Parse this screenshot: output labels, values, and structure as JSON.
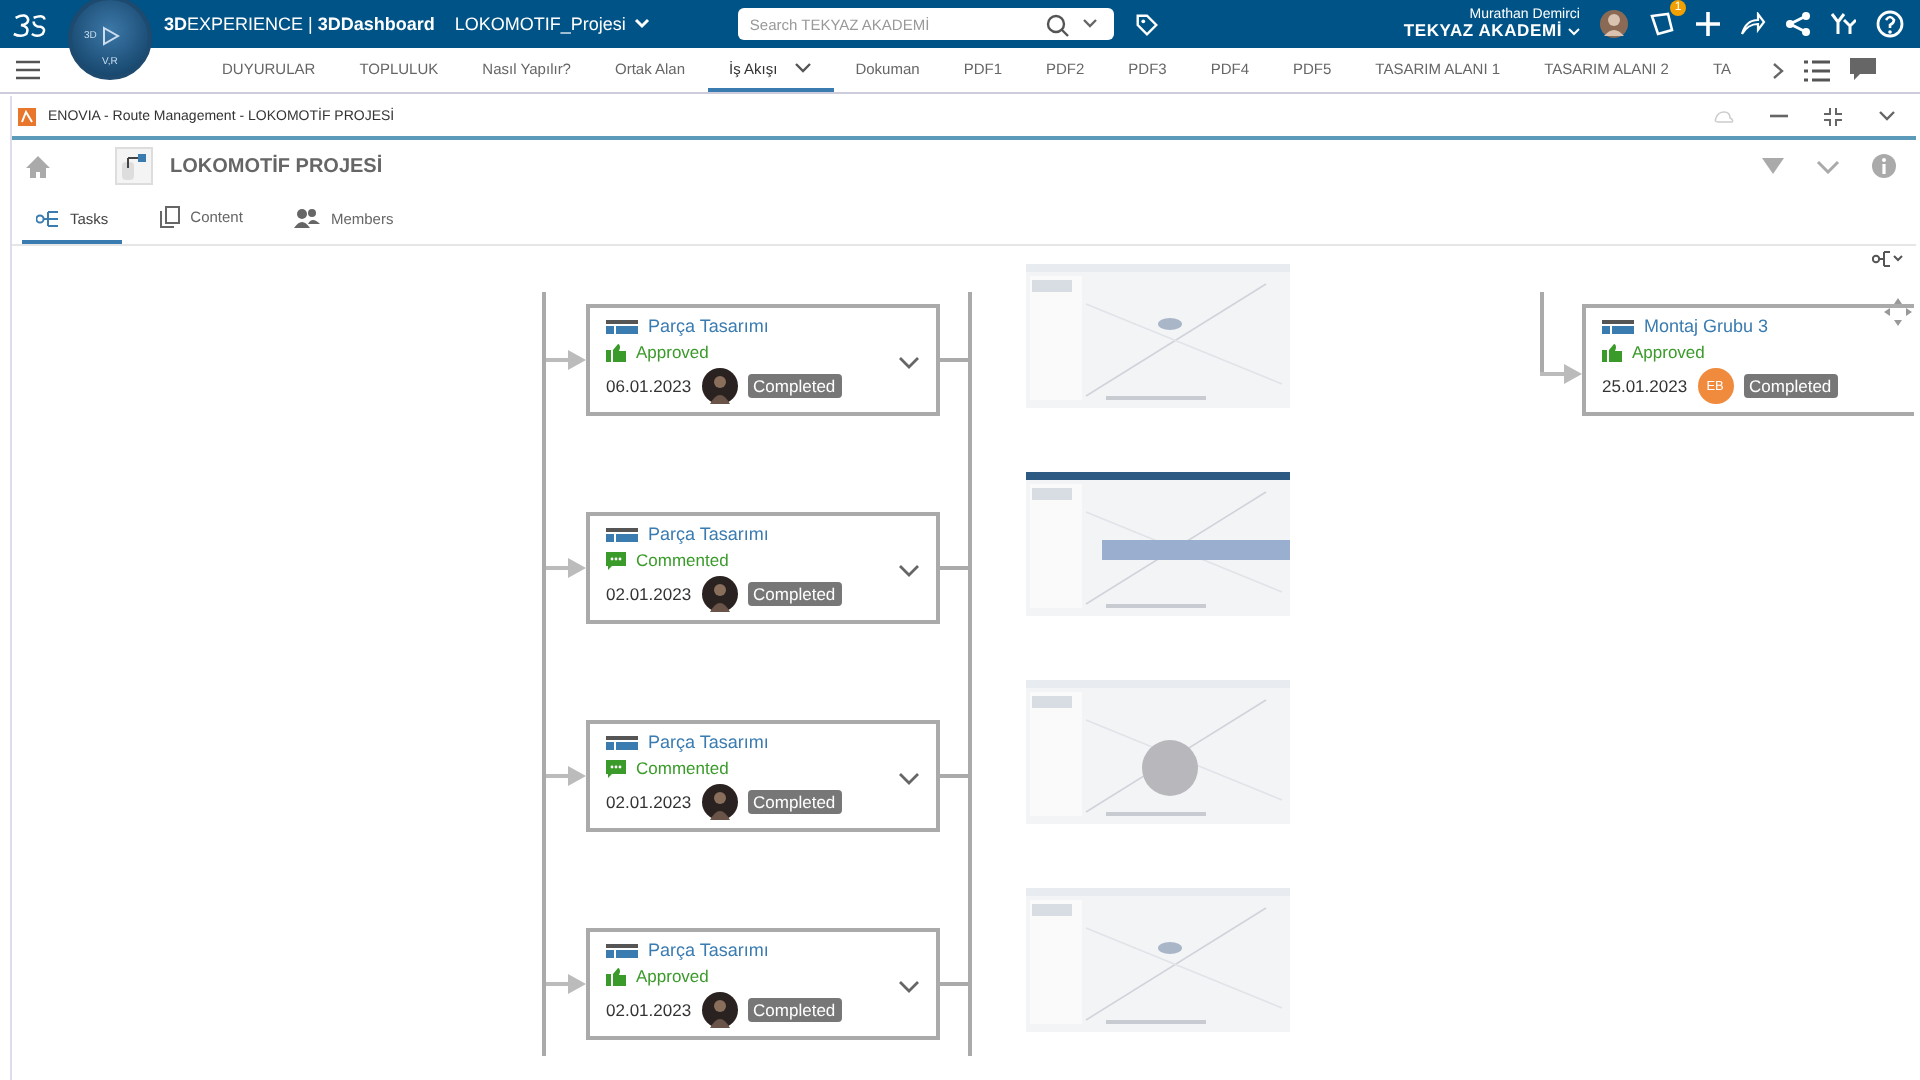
{
  "top_bar": {
    "compass_labels": [
      "3D",
      "V,R"
    ],
    "app_title": "**3D**EXPERIENCE | **3DDashboard**",
    "dashboard": "LOKOMOTIF_Projesi",
    "search": {
      "placeholder": "Search TEKYAZ AKADEMİ"
    },
    "user_name": "Murathan Demirci",
    "tenant": "TEKYAZ AKADEMİ",
    "notification_count": "1"
  },
  "nav_tabs": [
    {
      "label": "DUYURULAR",
      "selected": false
    },
    {
      "label": "TOPLULUK",
      "selected": false
    },
    {
      "label": "Nasıl Yapılır?",
      "selected": false
    },
    {
      "label": "Ortak Alan",
      "selected": false
    },
    {
      "label": "İş Akışı",
      "selected": true
    },
    {
      "label": "Dokuman",
      "selected": false
    },
    {
      "label": "PDF1",
      "selected": false
    },
    {
      "label": "PDF2",
      "selected": false
    },
    {
      "label": "PDF3",
      "selected": false
    },
    {
      "label": "PDF4",
      "selected": false
    },
    {
      "label": "PDF5",
      "selected": false
    },
    {
      "label": "TASARIM ALANI 1",
      "selected": false
    },
    {
      "label": "TASARIM ALANI 2",
      "selected": false
    },
    {
      "label": "TA",
      "selected": false
    }
  ],
  "widget": {
    "title": "ENOVIA - Route Management - LOKOMOTİF PROJESİ",
    "route_name": "LOKOMOTİF PROJESİ",
    "tabs": [
      {
        "label": "Tasks",
        "kind": "tasks",
        "selected": true
      },
      {
        "label": "Content",
        "kind": "content",
        "selected": false
      },
      {
        "label": "Members",
        "kind": "members",
        "selected": false
      }
    ]
  },
  "tasks": [
    {
      "title": "Parça Tasarımı",
      "status": {
        "kind": "approved",
        "label": "Approved"
      },
      "date": "06.01.2023",
      "badge": "Completed"
    },
    {
      "title": "Parça Tasarımı",
      "status": {
        "kind": "commented",
        "label": "Commented"
      },
      "date": "02.01.2023",
      "badge": "Completed"
    },
    {
      "title": "Parça Tasarımı",
      "status": {
        "kind": "commented",
        "label": "Commented"
      },
      "date": "02.01.2023",
      "badge": "Completed"
    },
    {
      "title": "Parça Tasarımı",
      "status": {
        "kind": "approved",
        "label": "Approved"
      },
      "date": "02.01.2023",
      "badge": "Completed"
    }
  ],
  "final_task": {
    "title": "Montaj Grubu 3",
    "status": {
      "kind": "approved",
      "label": "Approved"
    },
    "date": "25.01.2023",
    "avatar": {
      "kind": "initials",
      "text": "EB"
    },
    "badge": "Completed"
  }
}
